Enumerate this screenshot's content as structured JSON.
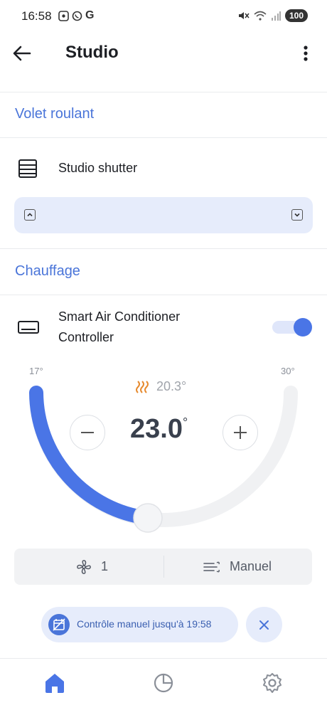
{
  "status_bar": {
    "time": "16:58",
    "left_icons": [
      "screenshot-icon",
      "whatsapp-icon"
    ],
    "g_label": "G",
    "battery": "100"
  },
  "app_bar": {
    "title": "Studio"
  },
  "shutter_section": {
    "title": "Volet roulant",
    "device_label": "Studio shutter"
  },
  "heating_section": {
    "title": "Chauffage",
    "device_label_line1": "Smart Air Conditioner",
    "device_label_line2": "Controller",
    "toggle_on": true,
    "min_label": "17°",
    "max_label": "30°",
    "current_temp": "20.3°",
    "setpoint": "23.0",
    "setpoint_unit": "°",
    "fan_speed": "1",
    "mode": "Manuel",
    "colors": {
      "accent": "#4a75e6",
      "heat": "#e68a2e",
      "track": "#f0f1f3"
    }
  },
  "override": {
    "text": "Contrôle manuel jusqu'à 19:58"
  }
}
